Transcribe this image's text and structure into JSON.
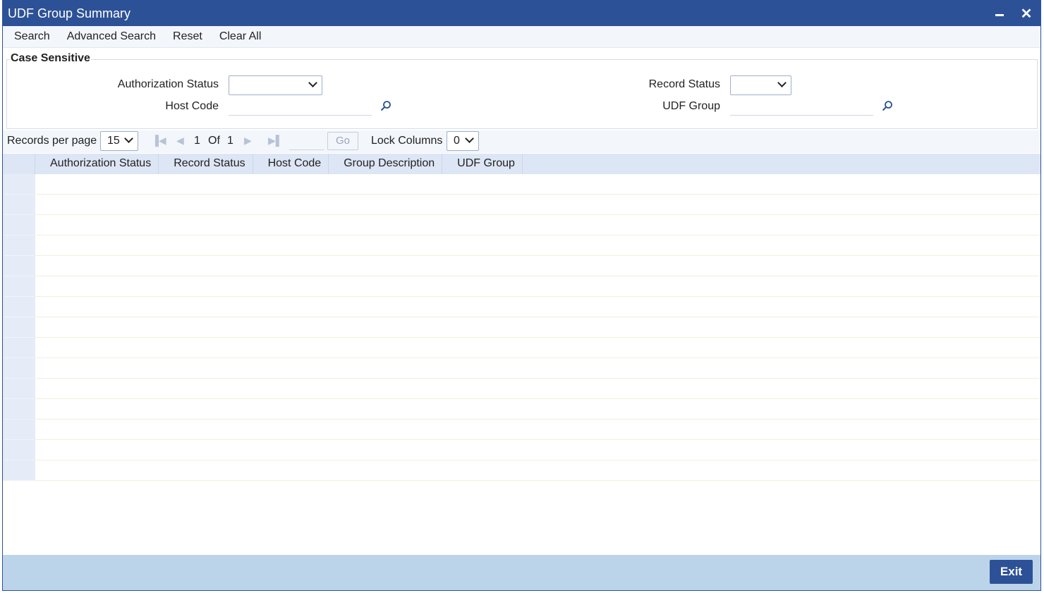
{
  "window": {
    "title": "UDF Group Summary",
    "minimize_icon": "minimize-icon",
    "close_icon": "close-icon"
  },
  "toolbar": {
    "search": "Search",
    "advanced_search": "Advanced Search",
    "reset": "Reset",
    "clear_all": "Clear All"
  },
  "criteria": {
    "legend": "Case Sensitive",
    "authorization_status_label": "Authorization Status",
    "authorization_status_value": "",
    "host_code_label": "Host Code",
    "host_code_value": "",
    "record_status_label": "Record Status",
    "record_status_value": "",
    "udf_group_label": "UDF Group",
    "udf_group_value": ""
  },
  "pager": {
    "records_per_page_label": "Records per page",
    "records_per_page_value": "15",
    "current_page": "1",
    "of_label": "Of",
    "total_pages": "1",
    "go_label": "Go",
    "lock_columns_label": "Lock Columns",
    "lock_columns_value": "0"
  },
  "grid": {
    "columns": [
      "Authorization Status",
      "Record Status",
      "Host Code",
      "Group Description",
      "UDF Group"
    ],
    "row_count": 15
  },
  "footer": {
    "exit_label": "Exit"
  },
  "colors": {
    "title_bar": "#2d5196",
    "footer": "#bcd4ea",
    "grid_header": "#dde6f4"
  }
}
